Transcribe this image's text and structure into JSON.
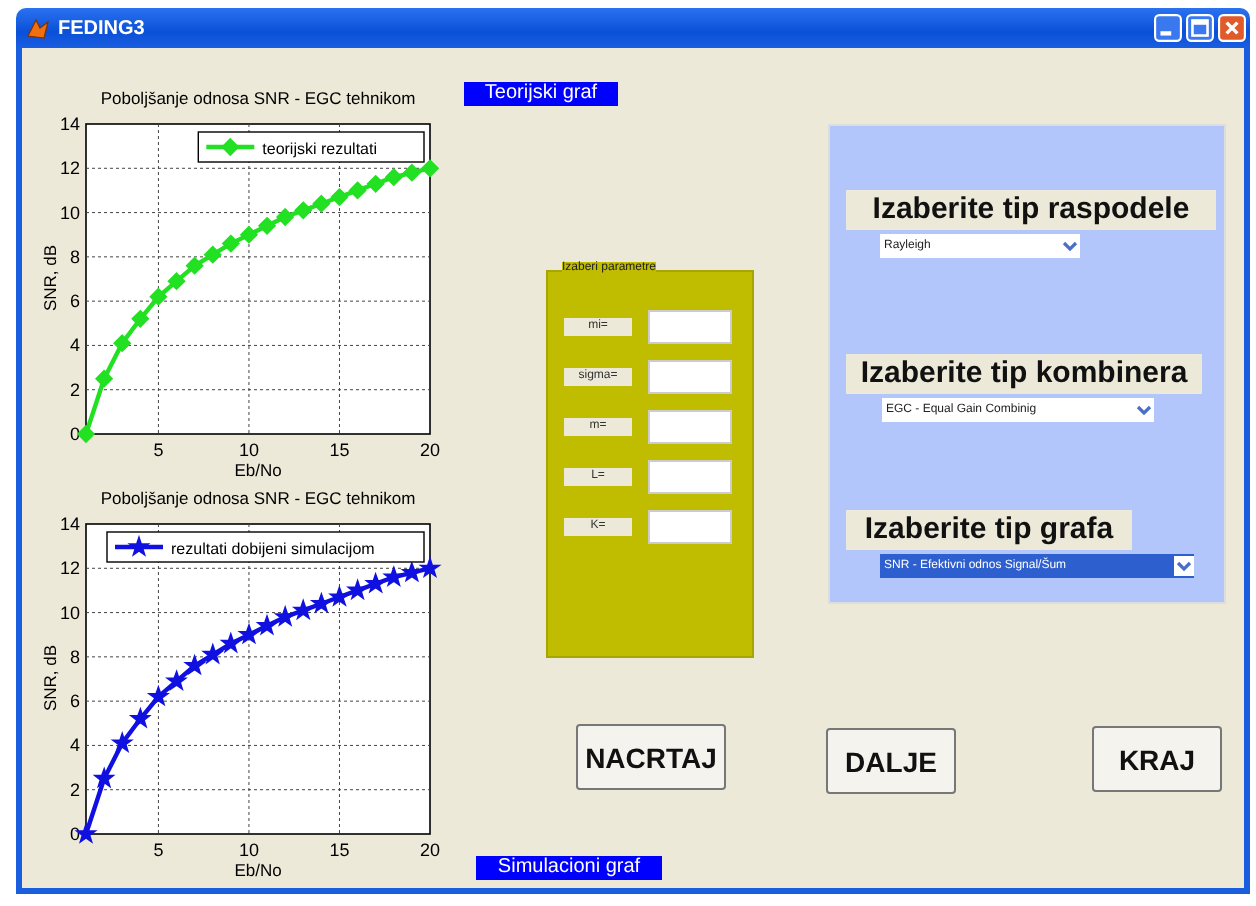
{
  "window": {
    "title": "FEDING3"
  },
  "theory_graph_label": "Teorijski graf",
  "simulation_graph_label": "Simulacioni graf",
  "charts": [
    {
      "chart_data": {
        "type": "line",
        "title": "Poboljšanje odnosa SNR - EGC tehnikom",
        "xlabel": "Eb/No",
        "ylabel": "SNR, dB",
        "grid": true,
        "x": [
          1,
          2,
          3,
          4,
          5,
          6,
          7,
          8,
          9,
          10,
          11,
          12,
          13,
          14,
          15,
          16,
          17,
          18,
          19,
          20
        ],
        "xlim": [
          1,
          20
        ],
        "ylim": [
          0,
          14
        ],
        "xticks": [
          5,
          10,
          15,
          20
        ],
        "yticks": [
          0,
          2,
          4,
          6,
          8,
          10,
          12,
          14
        ],
        "series": [
          {
            "name": "teorijski rezultati",
            "color": "#22e022",
            "marker": "diamond",
            "values": [
              0,
              2.5,
              4.1,
              5.2,
              6.2,
              6.9,
              7.6,
              8.1,
              8.6,
              9.0,
              9.4,
              9.8,
              10.1,
              10.4,
              10.7,
              11.0,
              11.3,
              11.6,
              11.8,
              12.0
            ]
          }
        ]
      }
    },
    {
      "chart_data": {
        "type": "line",
        "title": "Poboljšanje odnosa SNR - EGC tehnikom",
        "xlabel": "Eb/No",
        "ylabel": "SNR, dB",
        "grid": true,
        "x": [
          1,
          2,
          3,
          4,
          5,
          6,
          7,
          8,
          9,
          10,
          11,
          12,
          13,
          14,
          15,
          16,
          17,
          18,
          19,
          20
        ],
        "xlim": [
          1,
          20
        ],
        "ylim": [
          0,
          14
        ],
        "xticks": [
          5,
          10,
          15,
          20
        ],
        "yticks": [
          0,
          2,
          4,
          6,
          8,
          10,
          12,
          14
        ],
        "series": [
          {
            "name": "rezultati dobijeni simulacijom",
            "color": "#1010e0",
            "marker": "star",
            "values": [
              0,
              2.5,
              4.1,
              5.2,
              6.2,
              6.9,
              7.6,
              8.1,
              8.6,
              9.0,
              9.4,
              9.8,
              10.1,
              10.4,
              10.7,
              11.0,
              11.3,
              11.6,
              11.8,
              12.0
            ]
          }
        ]
      }
    }
  ],
  "parameters": {
    "title": "Izaberi parametre",
    "fields": [
      {
        "label": "mi="
      },
      {
        "label": "sigma="
      },
      {
        "label": "m="
      },
      {
        "label": "L="
      },
      {
        "label": "K="
      }
    ]
  },
  "selectors": [
    {
      "label": "Izaberite tip raspodele",
      "value": "Rayleigh",
      "selected": false
    },
    {
      "label": "Izaberite tip kombinera",
      "value": "EGC - Equal Gain Combinig",
      "selected": false
    },
    {
      "label": "Izaberite tip grafa",
      "value": "SNR - Efektivni odnos Signal/Šum",
      "selected": true
    }
  ],
  "buttons": [
    "NACRTAJ",
    "DALJE",
    "KRAJ"
  ]
}
